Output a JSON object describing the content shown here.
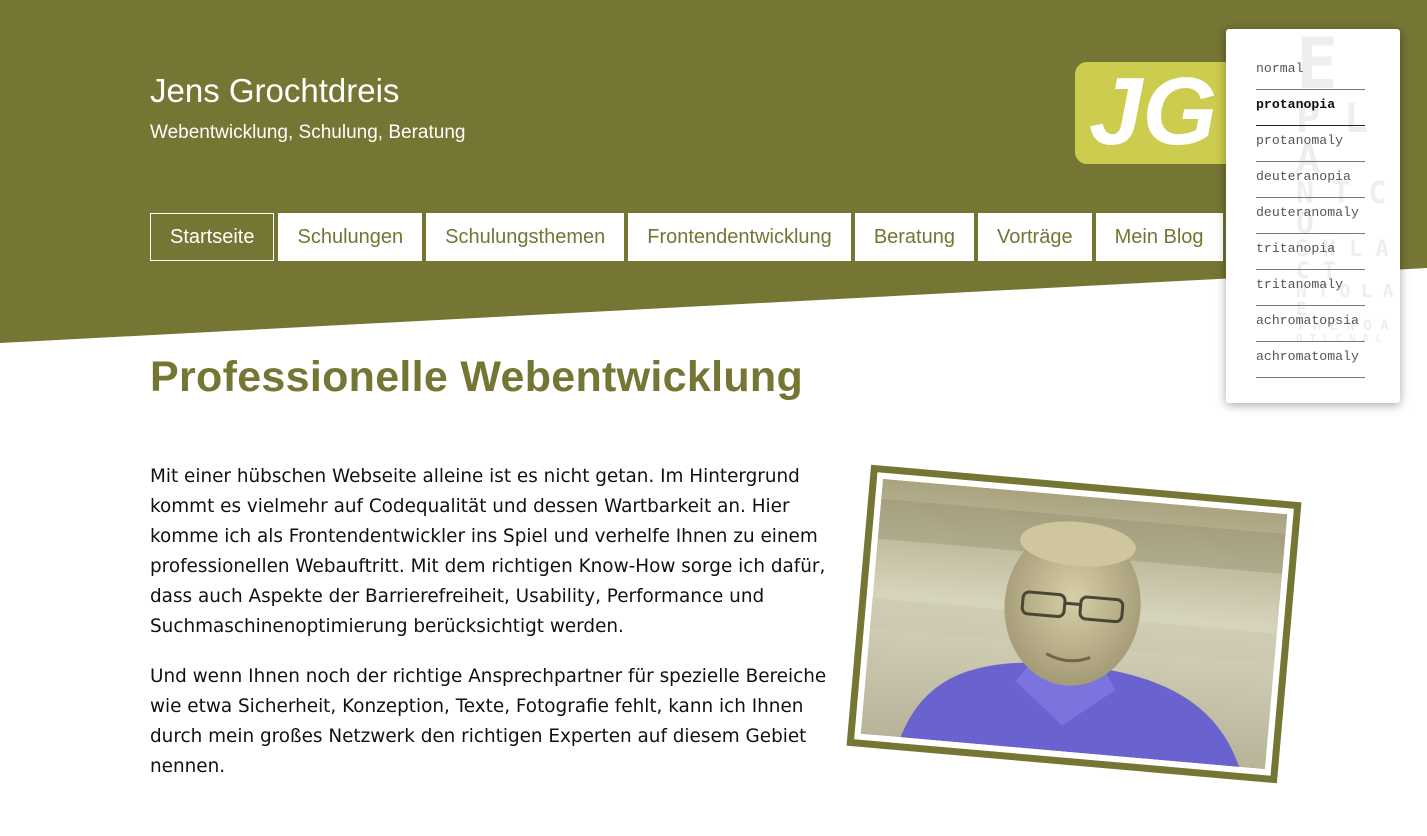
{
  "colors": {
    "brand": "#757534",
    "logo_accent": "#cccc4e",
    "white": "#ffffff"
  },
  "header": {
    "title": "Jens Grochtdreis",
    "tagline": "Webentwicklung, Schulung, Beratung",
    "logo_text": "JG"
  },
  "nav": {
    "items": [
      {
        "label": "Startseite",
        "active": true
      },
      {
        "label": "Schulungen"
      },
      {
        "label": "Schulungsthemen"
      },
      {
        "label": "Frontendentwicklung"
      },
      {
        "label": "Beratung"
      },
      {
        "label": "Vorträge"
      },
      {
        "label": "Mein Blog"
      }
    ]
  },
  "main": {
    "heading": "Professionelle Webentwicklung",
    "paragraphs": [
      "Mit einer hübschen Webseite alleine ist es nicht getan. Im Hintergrund kommt es vielmehr auf Codequalität und dessen Wartbarkeit an. Hier komme ich als Frontendentwickler ins Spiel und verhelfe Ihnen zu einem professionellen Webauftritt. Mit dem richtigen Know-How sorge ich dafür, dass auch Aspekte der Barrierefreiheit, Usability, Performance und Suchmaschinenoptimierung berücksichtigt werden.",
      "Und wenn Ihnen noch der richtige Ansprechpartner für spezielle Bereiche wie etwa Sicherheit, Konzeption, Texte, Fotografie fehlt, kann ich Ihnen durch mein großes Netzwerk den richtigen Experten auf diesem Gebiet nennen."
    ]
  },
  "color_filter_menu": {
    "options": [
      {
        "label": "normal"
      },
      {
        "label": "protanopia",
        "active": true
      },
      {
        "label": "protanomaly"
      },
      {
        "label": "deuteranopia"
      },
      {
        "label": "deuteranomaly"
      },
      {
        "label": "tritanopia"
      },
      {
        "label": "tritanomaly"
      },
      {
        "label": "achromatopsia"
      },
      {
        "label": "achromatomaly"
      }
    ],
    "eye_chart_lines": [
      "E",
      "P L A",
      "N T C O",
      "S H L A C T",
      "N T O L A E",
      "T H E N O A",
      "O T L C N A L"
    ]
  }
}
